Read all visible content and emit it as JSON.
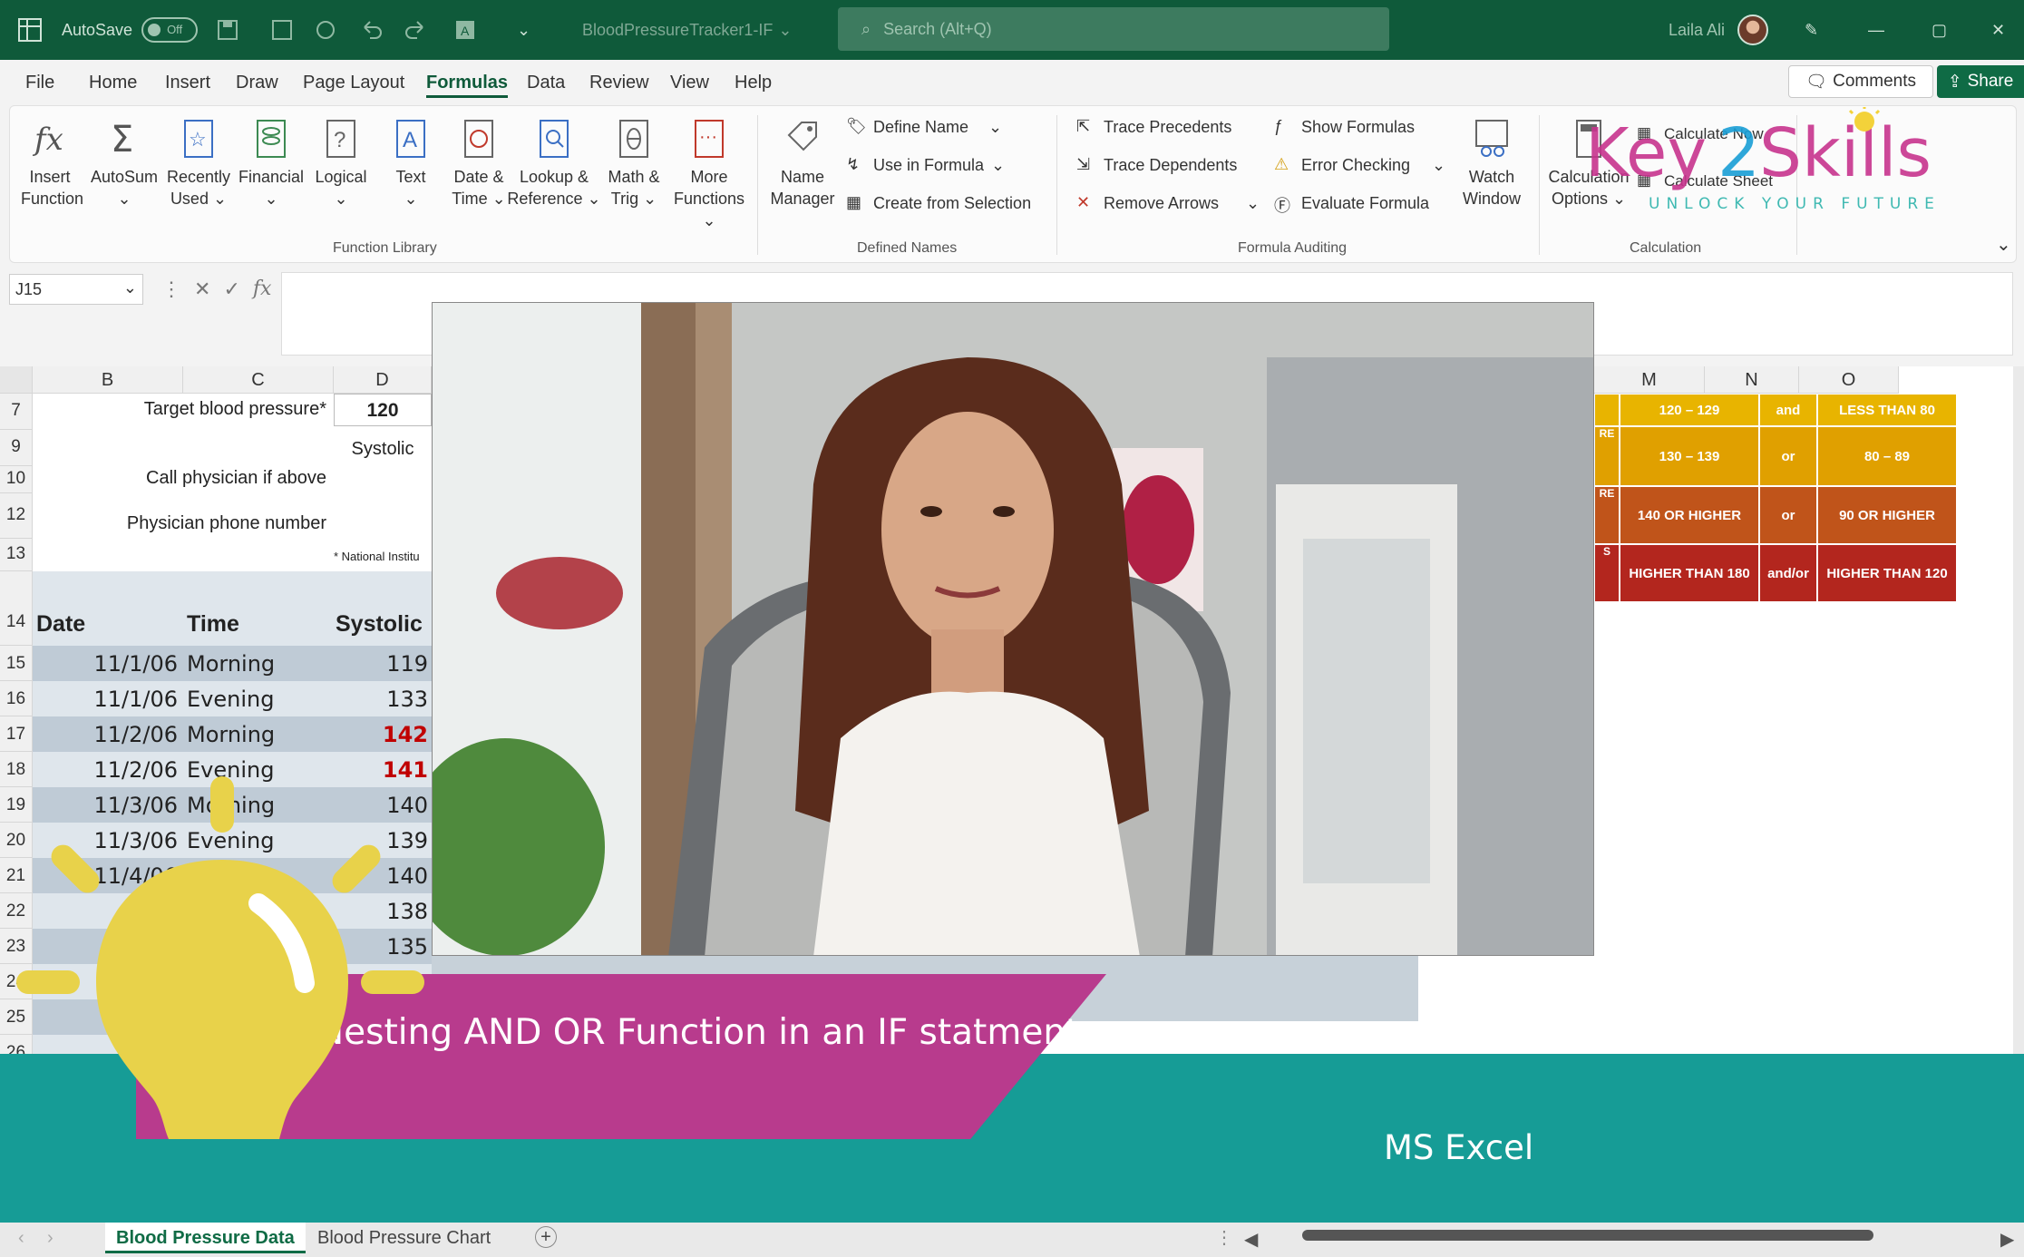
{
  "titlebar": {
    "autosave_label": "AutoSave",
    "autosave_state": "Off",
    "filename": "BloodPressureTracker1-IF",
    "search_placeholder": "Search (Alt+Q)",
    "user_name": "Laila Ali"
  },
  "menu": {
    "tabs": [
      "File",
      "Home",
      "Insert",
      "Draw",
      "Page Layout",
      "Formulas",
      "Data",
      "Review",
      "View",
      "Help"
    ],
    "active": "Formulas",
    "comments_label": "Comments",
    "share_label": "Share"
  },
  "ribbon": {
    "function_library": {
      "label": "Function Library",
      "buttons": [
        {
          "line1": "Insert",
          "line2": "Function"
        },
        {
          "line1": "AutoSum",
          "line2": "⌄"
        },
        {
          "line1": "Recently",
          "line2": "Used ⌄"
        },
        {
          "line1": "Financial",
          "line2": "⌄"
        },
        {
          "line1": "Logical",
          "line2": "⌄"
        },
        {
          "line1": "Text",
          "line2": "⌄"
        },
        {
          "line1": "Date &",
          "line2": "Time ⌄"
        },
        {
          "line1": "Lookup &",
          "line2": "Reference ⌄"
        },
        {
          "line1": "Math &",
          "line2": "Trig ⌄"
        },
        {
          "line1": "More",
          "line2": "Functions ⌄"
        }
      ]
    },
    "defined_names": {
      "label": "Defined Names",
      "name_manager": {
        "line1": "Name",
        "line2": "Manager"
      },
      "items": [
        "Define Name",
        "Use in Formula",
        "Create from Selection"
      ]
    },
    "formula_auditing": {
      "label": "Formula Auditing",
      "left_items": [
        "Trace Precedents",
        "Trace Dependents",
        "Remove Arrows"
      ],
      "right_items": [
        "Show Formulas",
        "Error Checking",
        "Evaluate Formula"
      ],
      "watch_window": {
        "line1": "Watch",
        "line2": "Window"
      }
    },
    "calculation": {
      "label": "Calculation",
      "options": {
        "line1": "Calculation",
        "line2": "Options ⌄"
      },
      "items": [
        "Calculate Now",
        "Calculate Sheet"
      ]
    }
  },
  "formula_bar": {
    "name_box": "J15",
    "fx": "fx"
  },
  "sheet": {
    "columns_left": [
      "B",
      "C",
      "D"
    ],
    "columns_right": [
      "M",
      "N",
      "O"
    ],
    "header_rows": [
      {
        "row": "7",
        "label": "Target blood pressure*",
        "value": "120"
      },
      {
        "row": "9",
        "label": "",
        "value": "Systolic"
      },
      {
        "row": "10",
        "label": "Call physician if above",
        "value": ""
      },
      {
        "row": "12",
        "label": "Physician phone number",
        "value": ""
      },
      {
        "row": "13",
        "label": "",
        "value": "* National Institu"
      }
    ],
    "table_header": {
      "row": "14",
      "date": "Date",
      "time": "Time",
      "systolic": "Systolic"
    },
    "data_rows": [
      {
        "row": "15",
        "date": "11/1/06",
        "time": "Morning",
        "systolic": "119",
        "alert": false
      },
      {
        "row": "16",
        "date": "11/1/06",
        "time": "Evening",
        "systolic": "133",
        "alert": false
      },
      {
        "row": "17",
        "date": "11/2/06",
        "time": "Morning",
        "systolic": "142",
        "alert": true
      },
      {
        "row": "18",
        "date": "11/2/06",
        "time": "Evening",
        "systolic": "141",
        "alert": true
      },
      {
        "row": "19",
        "date": "11/3/06",
        "time": "Morning",
        "systolic": "140",
        "alert": false
      },
      {
        "row": "20",
        "date": "11/3/06",
        "time": "Evening",
        "systolic": "139",
        "alert": false
      },
      {
        "row": "21",
        "date": "11/4/06",
        "time": "",
        "systolic": "140",
        "alert": false
      },
      {
        "row": "22",
        "date": "",
        "time": "",
        "systolic": "138",
        "alert": false
      },
      {
        "row": "23",
        "date": "",
        "time": "",
        "systolic": "135",
        "alert": false
      },
      {
        "row": "24",
        "date": "",
        "time": "",
        "systolic": "",
        "alert": false
      },
      {
        "row": "25",
        "date": "",
        "time": "",
        "systolic": "",
        "alert": false
      },
      {
        "row": "26",
        "date": "",
        "time": "",
        "systolic": "",
        "alert": false
      }
    ],
    "bp_table": [
      {
        "m": "120 – 129",
        "n": "and",
        "o": "LESS THAN 80",
        "side": "",
        "color": "#e8b400"
      },
      {
        "m": "130 – 139",
        "n": "or",
        "o": "80 – 89",
        "side": "RE",
        "color": "#e0a000"
      },
      {
        "m": "140 OR HIGHER",
        "n": "or",
        "o": "90 OR HIGHER",
        "side": "RE",
        "color": "#c0541a"
      },
      {
        "m": "HIGHER THAN 180",
        "n": "and/or",
        "o": "HIGHER THAN 120",
        "side": "S",
        "color": "#b3261e"
      }
    ],
    "sheet_tabs": [
      "Blood Pressure Data",
      "Blood Pressure Chart"
    ],
    "active_sheet": "Blood Pressure Data"
  },
  "overlay": {
    "banner_title": "Nesting AND OR Function in an IF statment",
    "course_label": "MS Excel",
    "logo_main": "Key2Skills",
    "logo_tagline": "UNLOCK YOUR FUTURE"
  },
  "colors": {
    "title_bar": "#0f5a3a",
    "banner_pink": "#b83b8d",
    "banner_teal": "#169c96",
    "bulb_yellow": "#e8d24a",
    "alert_red": "#c00000"
  }
}
